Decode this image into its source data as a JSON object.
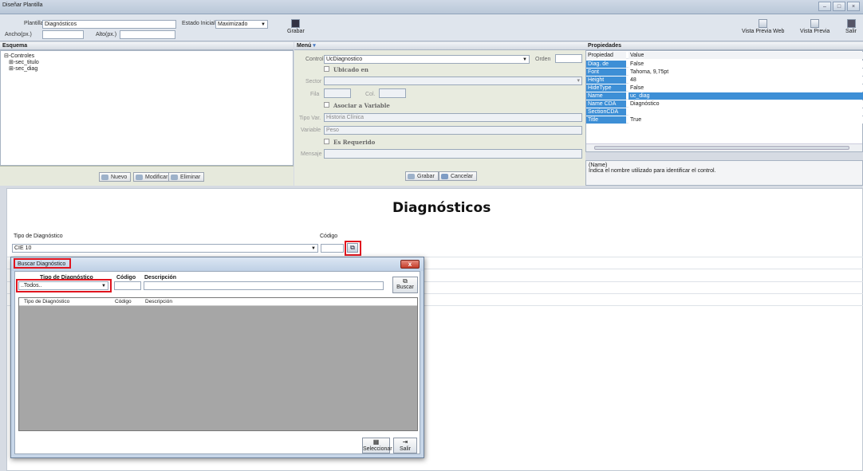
{
  "window": {
    "title": "Diseñar Plantilla"
  },
  "toolbar": {
    "plantilla_label": "Plantilla",
    "plantilla_value": "Diagnósticos",
    "estado_label": "Estado Inicial",
    "estado_value": "Maximizado",
    "ancho_label": "Ancho(px.)",
    "ancho_value": "",
    "alto_label": "Alto(px.)",
    "alto_value": "",
    "grabar_label": "Grabar",
    "vista_web_label": "Vista Previa Web",
    "vista_previa_label": "Vista Previa",
    "salir_label": "Salir"
  },
  "esquema": {
    "header": "Esquema",
    "tree": [
      "⊟-Controles",
      "⊞-sec_titulo",
      "⊞-sec_diag"
    ],
    "nuevo": "Nuevo",
    "modificar": "Modificar",
    "eliminar": "Eliminar"
  },
  "menu": {
    "header": "Menú",
    "control_label": "Control",
    "control_value": "UcDiagnostico",
    "orden_label": "Orden",
    "orden_value": "",
    "ubicado_label": "Ubicado en",
    "sector_label": "Sector",
    "fila_label": "Fila",
    "col_label": "Col.",
    "asociar_label": "Asociar a Variable",
    "tipovar_label": "Tipo Var.",
    "tipovar_value": "Historia Clínica",
    "variable_label": "Variable",
    "variable_value": "Peso",
    "requerido_label": "Es Requerido",
    "mensaje_label": "Mensaje",
    "grabar": "Grabar",
    "cancelar": "Cancelar"
  },
  "propiedades": {
    "header": "Propiedades",
    "col_prop": "Propiedad",
    "col_value": "Value",
    "rows": [
      {
        "name": "Diag. de Egreso",
        "value": "False"
      },
      {
        "name": "Font",
        "value": "Tahoma, 9,75pt"
      },
      {
        "name": "Height",
        "value": "48"
      },
      {
        "name": "HideType",
        "value": "False"
      },
      {
        "name": "Name",
        "value": "uc_diag"
      },
      {
        "name": "Name CDA",
        "value": "Diagnóstico"
      },
      {
        "name": "SectionCDA",
        "value": ""
      },
      {
        "name": "Title",
        "value": "True"
      }
    ],
    "desc_title": "(Name)",
    "desc_text": "Indica el nombre utilizado para identificar el control."
  },
  "designer": {
    "title": "Diagnósticos",
    "tipo_label": "Tipo de Diagnóstico",
    "tipo_value": "CIE 10",
    "codigo_label": "Código"
  },
  "dialog": {
    "title": "Buscar Diagnóstico",
    "tipo_label": "Tipo de Diagnóstico",
    "tipo_value": "..Todos..",
    "codigo_label": "Código",
    "descripcion_label": "Descripción",
    "buscar": "Buscar",
    "columns": [
      "Tipo de Diagnóstico",
      "Código",
      "Descripción"
    ],
    "seleccionar": "Seleccionar",
    "salir": "Salir"
  },
  "colors": {
    "accent": "#3d8fd6",
    "highlight": "#e0141e"
  }
}
